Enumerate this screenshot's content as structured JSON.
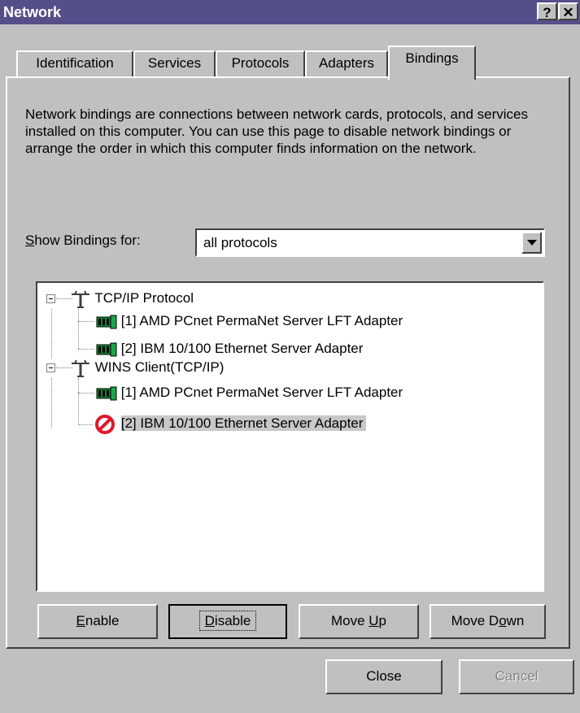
{
  "window": {
    "title": "Network",
    "help_glyph": "?",
    "close_glyph": "✕"
  },
  "tabs": [
    {
      "label": "Identification"
    },
    {
      "label": "Services"
    },
    {
      "label": "Protocols"
    },
    {
      "label": "Adapters"
    },
    {
      "label": "Bindings",
      "active": true
    }
  ],
  "description": "Network bindings are connections between network cards, protocols, and services installed on this computer.  You can use this page to disable network bindings or arrange the order in which this computer finds information on the network.",
  "show_bindings": {
    "label_pre": "",
    "label_accel": "S",
    "label_post": "how Bindings for:",
    "value": "all protocols"
  },
  "tree": {
    "groups": [
      {
        "label": "TCP/IP Protocol",
        "children": [
          {
            "label": "[1] AMD PCnet PermaNet Server LFT Adapter",
            "status": "enabled"
          },
          {
            "label": "[2] IBM 10/100 Ethernet Server Adapter",
            "status": "enabled"
          }
        ]
      },
      {
        "label": "WINS Client(TCP/IP)",
        "children": [
          {
            "label": "[1] AMD PCnet PermaNet Server LFT Adapter",
            "status": "enabled"
          },
          {
            "label": "[2] IBM 10/100 Ethernet Server Adapter",
            "status": "disabled",
            "selected": true
          }
        ]
      }
    ]
  },
  "buttons": {
    "enable": {
      "pre": "",
      "accel": "E",
      "post": "nable"
    },
    "disable": {
      "pre": "",
      "accel": "D",
      "post": "isable"
    },
    "move_up": {
      "pre": "Move ",
      "accel": "U",
      "post": "p"
    },
    "move_down": {
      "pre": "Move D",
      "accel": "o",
      "post": "wn"
    },
    "close": {
      "label": "Close"
    },
    "cancel": {
      "label": "Cancel"
    }
  },
  "colors": {
    "titlebar": "#554f89",
    "face": "#c0c0c0",
    "disabled_icon": "#e0192a",
    "adapter_icon": "#0c8a2e"
  }
}
